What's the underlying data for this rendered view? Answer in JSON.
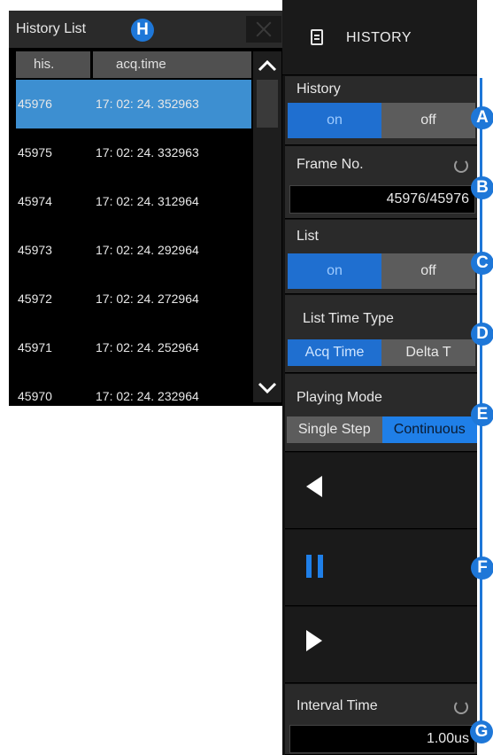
{
  "list_panel": {
    "title": "History List",
    "columns": {
      "his": "his.",
      "acq_time": "acq.time"
    },
    "rows": [
      {
        "his": "45976",
        "acq_time": "17: 02: 24. 352963"
      },
      {
        "his": "45975",
        "acq_time": "17: 02: 24. 332963"
      },
      {
        "his": "45974",
        "acq_time": "17: 02: 24. 312964"
      },
      {
        "his": "45973",
        "acq_time": "17: 02: 24. 292964"
      },
      {
        "his": "45972",
        "acq_time": "17: 02: 24. 272964"
      },
      {
        "his": "45971",
        "acq_time": "17: 02: 24. 252964"
      },
      {
        "his": "45970",
        "acq_time": "17: 02: 24. 232964"
      }
    ],
    "selected_row": 0
  },
  "menu": {
    "title": "HISTORY",
    "history": {
      "label": "History",
      "on": "on",
      "off": "off",
      "value": "on"
    },
    "frame_no": {
      "label": "Frame No.",
      "value": "45976/45976"
    },
    "list": {
      "label": "List",
      "on": "on",
      "off": "off",
      "value": "on"
    },
    "list_time_type": {
      "label": "List Time Type",
      "acq_time": "Acq Time",
      "delta_t": "Delta T",
      "value": "Acq Time"
    },
    "playing_mode": {
      "label": "Playing Mode",
      "single_step": "Single Step",
      "continuous": "Continuous",
      "value": "Continuous"
    },
    "playback": {
      "back_icon": "play-backward-icon",
      "pause_icon": "pause-icon",
      "forward_icon": "play-forward-icon"
    },
    "interval_time": {
      "label": "Interval Time",
      "value": "1.00us"
    }
  },
  "badges": {
    "a": "A",
    "b": "B",
    "c": "C",
    "d": "D",
    "e": "E",
    "f": "F",
    "g": "G",
    "h": "H"
  },
  "colors": {
    "accent": "#1e77d8",
    "selected_row": "#3d8fd1",
    "option_on": "#1f6fd0",
    "option_off": "#5c5c5c",
    "panel_bg": "#2a2a2a"
  }
}
